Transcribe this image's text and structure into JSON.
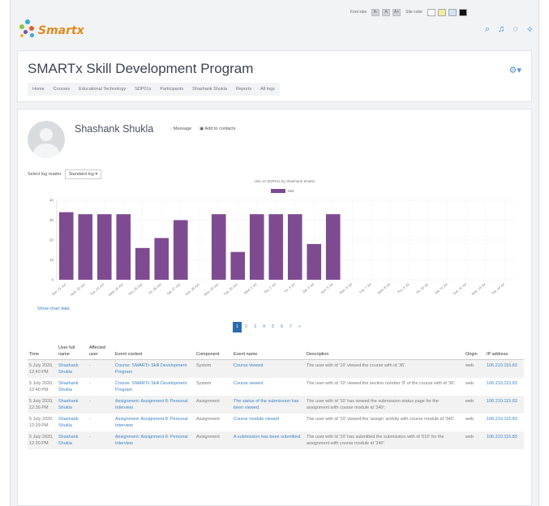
{
  "accessibility": {
    "font_size_label": "Font size",
    "font_buttons": [
      "A-",
      "A",
      "A+"
    ],
    "site_color_label": "Site color",
    "site_colors": [
      "#ffffff",
      "#f5eaa0",
      "#cfe3f5",
      "#111111"
    ]
  },
  "navbar": {
    "logo_text": "Smartx",
    "icons": [
      "search-icon",
      "bell-icon",
      "chat-icon",
      "user-menu-icon"
    ]
  },
  "header": {
    "title": "SMARTx Skill Development Program",
    "tabs": [
      "Home",
      "Courses",
      "Educational Technology",
      "SDP01s",
      "Participants",
      "Shashank Shukla",
      "Reports",
      "All logs"
    ]
  },
  "profile": {
    "name": "Shashank Shukla",
    "message_label": "Message",
    "add_contacts_label": "Add to contacts"
  },
  "log_reader": {
    "label": "Select log reader",
    "value": "Standard log"
  },
  "chart_data": {
    "type": "bar",
    "title": "Hits on SDP01s by Shashank Shukla",
    "legend": [
      "Hits"
    ],
    "color": "#7e4b91",
    "ylim": [
      0,
      40
    ],
    "yticks": [
      0,
      10,
      20,
      30,
      40
    ],
    "categories": [
      "Sun, 21 Jun",
      "Mon, 22 Jun",
      "Tue, 23 Jun",
      "Wed, 24 Jun",
      "Thu, 25 Jun",
      "Fri, 26 Jun",
      "Sat, 27 Jun",
      "Sun, 28 Jun",
      "Mon, 29 Jun",
      "Tue, 30 Jun",
      "Wed, 1 Jul",
      "Thu, 2 Jul",
      "Fri, 3 Jul",
      "Sat, 4 Jul",
      "Sun, 5 Jul",
      "Mon, 6 Jul",
      "Tue, 7 Jul",
      "Wed, 8 Jul",
      "Thu, 9 Jul",
      "Fri, 10 Jul",
      "Sat, 11 Jul",
      "Sun, 12 Jul",
      "Mon, 13 Jul",
      "Tue, 14 Jul"
    ],
    "values": [
      34,
      33,
      33,
      33,
      16,
      21,
      30,
      0,
      33,
      14,
      33,
      33,
      33,
      18,
      33,
      0,
      0,
      0,
      0,
      0,
      0,
      0,
      0,
      0
    ]
  },
  "show_chart_data": "Show chart data",
  "pagination": [
    "1",
    "2",
    "3",
    "4",
    "5",
    "6",
    "7",
    "»"
  ],
  "table": {
    "headers": [
      "Time",
      "User full name",
      "Affected user",
      "Event context",
      "Component",
      "Event name",
      "Description",
      "Origin",
      "IP address"
    ],
    "rows": [
      [
        "5 July 2020, 12:40 PM",
        "Shashank Shukla",
        "-",
        "Course: SMARTx Skill Development Program",
        "System",
        "Course viewed",
        "The user with id '10' viewed the course with id '36'.",
        "web",
        "106.210.115.83"
      ],
      [
        "5 July 2020, 12:40 PM",
        "Shashank Shukla",
        "-",
        "Course: SMARTx Skill Development Program",
        "System",
        "Course viewed",
        "The user with id '10' viewed the section number '8' of the course with id '36'.",
        "web",
        "106.210.115.83"
      ],
      [
        "5 July 2020, 12:39 PM",
        "Shashank Shukla",
        "-",
        "Assignment: Assignment 8: Personal Interview",
        "Assignment",
        "The status of the submission has been viewed.",
        "The user with id '10' has viewed the submission status page for the assignment with course module id '340'.",
        "web",
        "106.210.115.83"
      ],
      [
        "5 July 2020, 12:29 PM",
        "Shashank Shukla",
        "-",
        "Assignment: Assignment 8: Personal Interview",
        "Assignment",
        "Course module viewed",
        "The user with id '10' viewed the 'assign' activity with course module id '340'.",
        "web",
        "106.210.115.83"
      ],
      [
        "5 July 2020, 12:30 PM",
        "Shashank Shukla",
        "-",
        "Assignment: Assignment 8: Personal Interview",
        "Assignment",
        "A submission has been submitted.",
        "The user with id '10' has submitted the submission with id '510' for the assignment with course module id '340'.",
        "web",
        "106.210.115.83"
      ]
    ]
  }
}
